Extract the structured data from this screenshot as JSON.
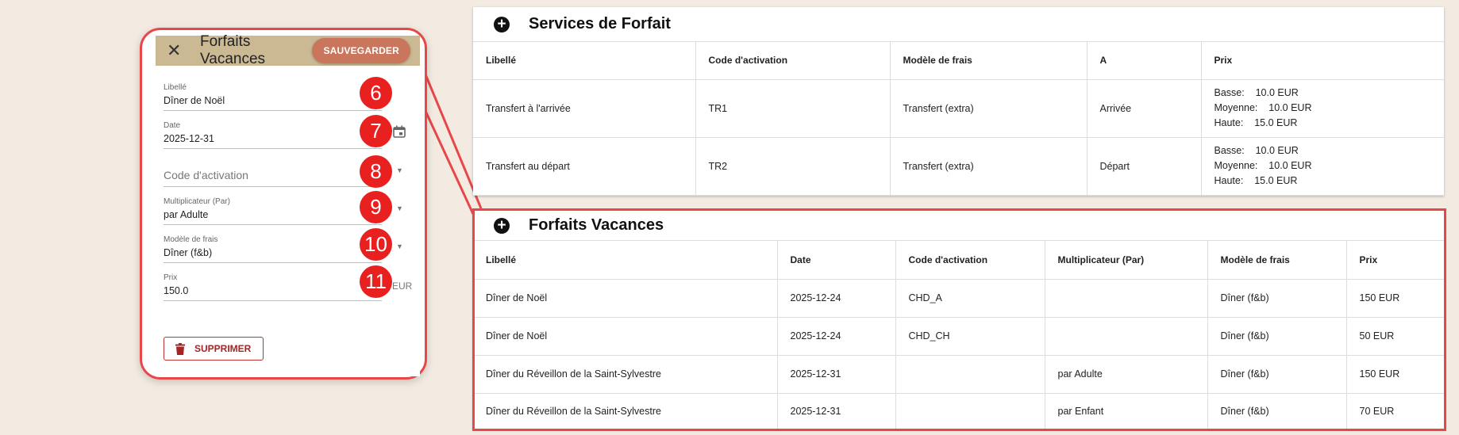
{
  "dialog": {
    "title": "Forfaits Vacances",
    "save_label": "SAUVEGARDER",
    "fields": {
      "libelle": {
        "label": "Libellé",
        "value": "Dîner de Noël"
      },
      "date": {
        "label": "Date",
        "value": "2025-12-31"
      },
      "code": {
        "placeholder": "Code d'activation"
      },
      "multiplicateur": {
        "label": "Multiplicateur (Par)",
        "value": "par Adulte"
      },
      "modele": {
        "label": "Modèle de frais",
        "value": "Dîner (f&b)"
      },
      "prix": {
        "label": "Prix",
        "value": "150.0",
        "suffix": "EUR"
      }
    },
    "delete_label": "SUPPRIMER",
    "markers": [
      "6",
      "7",
      "8",
      "9",
      "10",
      "11"
    ]
  },
  "services": {
    "title": "Services de Forfait",
    "columns": [
      "Libellé",
      "Code d'activation",
      "Modèle de frais",
      "A",
      "Prix"
    ],
    "rows": [
      {
        "libelle": "Transfert à l'arrivée",
        "code": "TR1",
        "modele": "Transfert (extra)",
        "a": "Arrivée",
        "prices": [
          "Basse:    10.0 EUR",
          "Moyenne:    10.0 EUR",
          "Haute:    15.0 EUR"
        ]
      },
      {
        "libelle": "Transfert au départ",
        "code": "TR2",
        "modele": "Transfert (extra)",
        "a": "Départ",
        "prices": [
          "Basse:    10.0 EUR",
          "Moyenne:    10.0 EUR",
          "Haute:    15.0 EUR"
        ]
      }
    ]
  },
  "forfaits": {
    "title": "Forfaits Vacances",
    "columns": [
      "Libellé",
      "Date",
      "Code d'activation",
      "Multiplicateur (Par)",
      "Modèle de frais",
      "Prix"
    ],
    "rows": [
      {
        "libelle": "Dîner de Noël",
        "date": "2025-12-24",
        "code": "CHD_A",
        "mult": "",
        "modele": "Dîner (f&b)",
        "prix": "150 EUR"
      },
      {
        "libelle": "Dîner de Noël",
        "date": "2025-12-24",
        "code": "CHD_CH",
        "mult": "",
        "modele": "Dîner (f&b)",
        "prix": "50 EUR"
      },
      {
        "libelle": "Dîner du Réveillon de la Saint-Sylvestre",
        "date": "2025-12-31",
        "code": "",
        "mult": "par Adulte",
        "modele": "Dîner (f&b)",
        "prix": "150 EUR"
      },
      {
        "libelle": "Dîner du Réveillon de la Saint-Sylvestre",
        "date": "2025-12-31",
        "code": "",
        "mult": "par Enfant",
        "modele": "Dîner (f&b)",
        "prix": "70 EUR"
      }
    ]
  },
  "colors": {
    "accent": "#e8474a",
    "header": "#cbb994",
    "save": "#c9765c",
    "marker": "#e8201f"
  }
}
